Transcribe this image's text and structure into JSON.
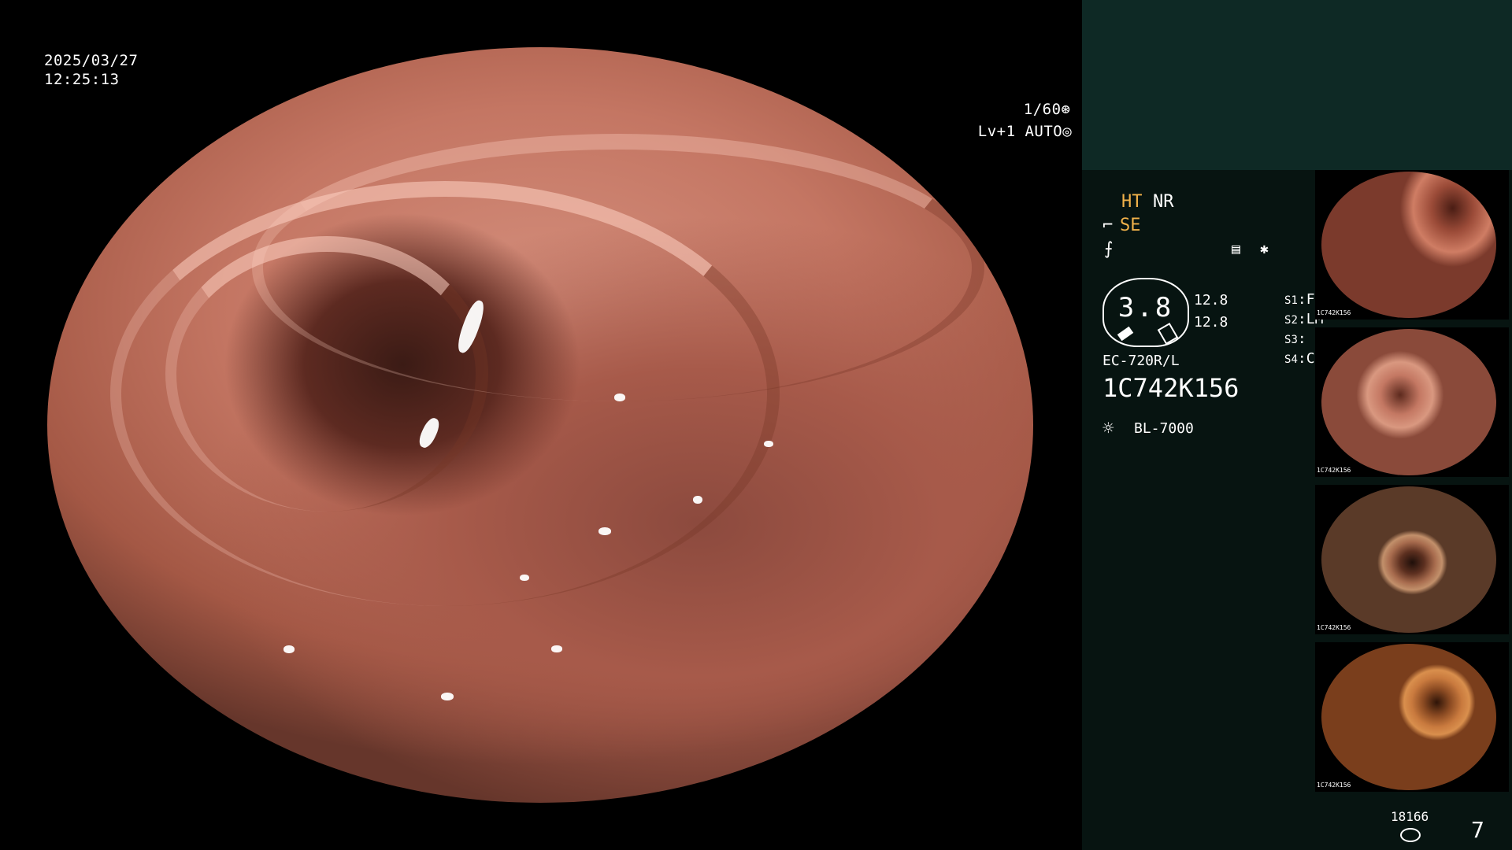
{
  "overlay": {
    "date": "2025/03/27",
    "time": "12:25:13",
    "shutter": "1/60",
    "mode_level": "Lv+1",
    "mode": "AUTO"
  },
  "info": {
    "ht": "HT",
    "nr": "NR",
    "se_prefix": "⌐",
    "se": "SE",
    "f_symbol": "⨍",
    "star": "✱",
    "gauge_value": "3.8",
    "side_values": [
      "12.8",
      "12.8"
    ],
    "s_settings": [
      {
        "key": "S1",
        "value": "F+T"
      },
      {
        "key": "S2",
        "value": "LM"
      },
      {
        "key": "S3",
        "value": ""
      },
      {
        "key": "S4",
        "value": "CAD"
      }
    ],
    "scope_model": "EC-720R/L",
    "serial": "1C742K156",
    "light_source": "BL-7000"
  },
  "thumbnails": [
    {
      "label": "1C742K156"
    },
    {
      "label": "1C742K156"
    },
    {
      "label": "1C742K156"
    },
    {
      "label": "1C742K156"
    }
  ],
  "footer": {
    "storage_count": "18166",
    "image_count": "7"
  },
  "colors": {
    "orange_accent": "#f2b24a",
    "panel_dark": "#071411",
    "panel_teal": "#0e2925"
  },
  "icons": {
    "shutter_icon": "aperture-icon",
    "auto_icon": "iris-icon",
    "light_icon": "sun-icon",
    "storage_icon": "disk-stack-icon",
    "menu_icon": "panel-icon"
  }
}
